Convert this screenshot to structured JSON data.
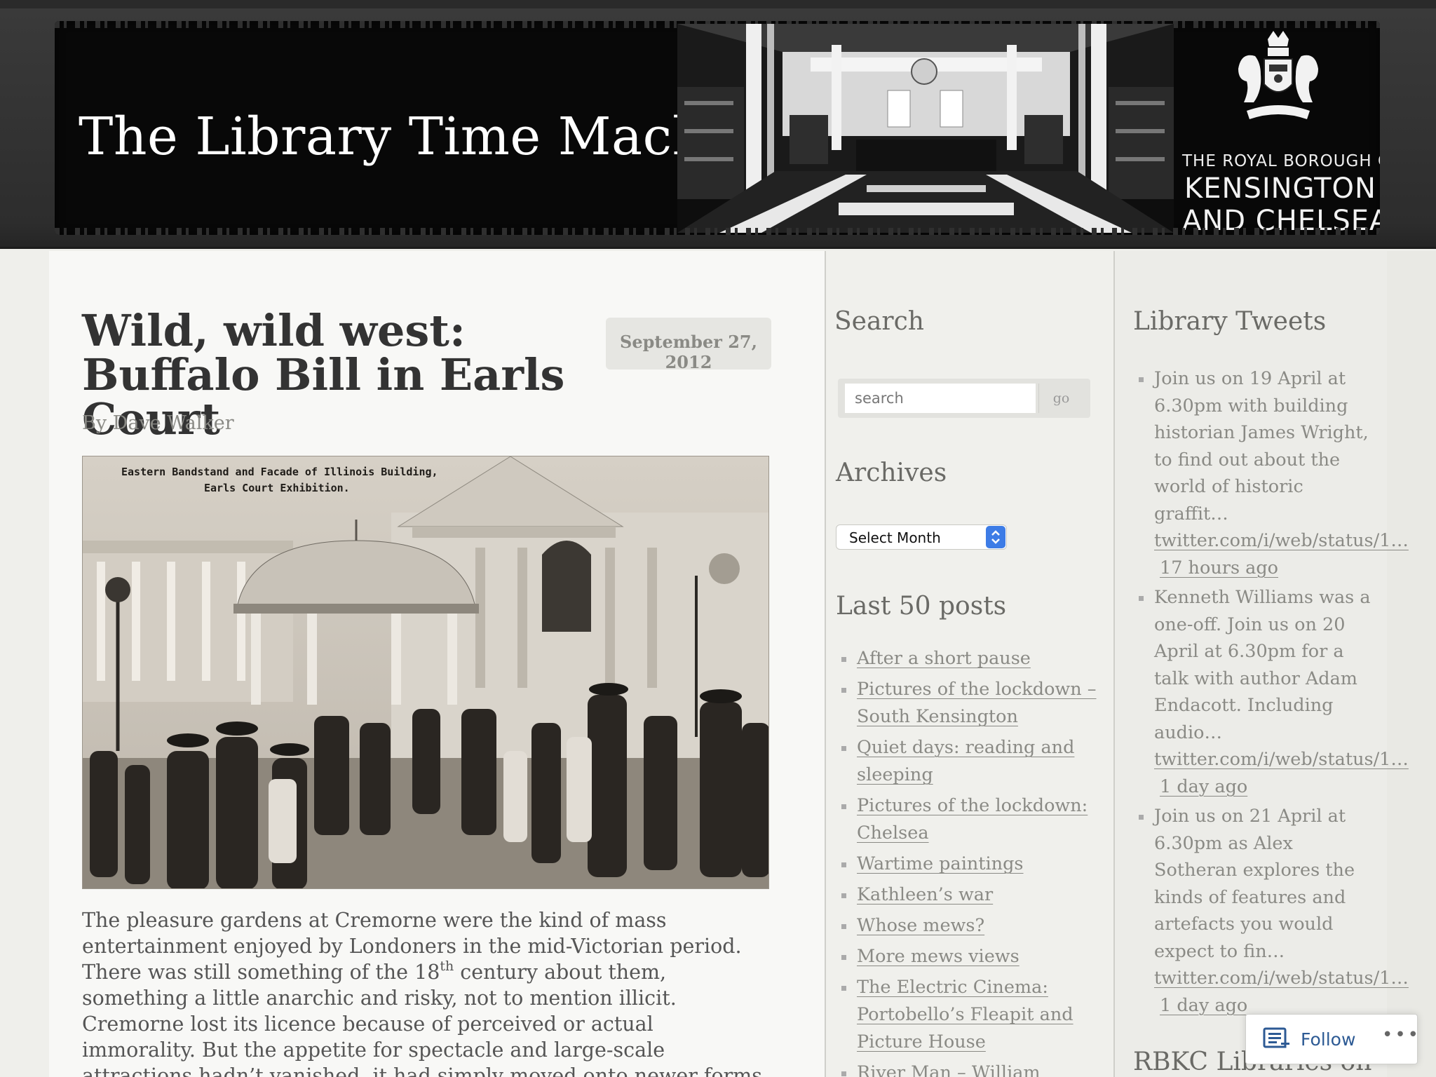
{
  "header": {
    "site_title": "The Library Time Machine",
    "borough_line1": "THE ROYAL BOROUGH OF",
    "borough_line2": "KENSINGTON",
    "borough_line3": "AND CHELSEA"
  },
  "post": {
    "title": "Wild, wild west: Buffalo Bill in Earls Court",
    "date": "September 27, 2012",
    "byline": "By Dave Walker",
    "image_caption_line1": "Eastern Bandstand and Facade of Illinois Building,",
    "image_caption_line2": "Earls Court Exhibition.",
    "body_part1": "The pleasure gardens at Cremorne were the kind of mass entertainment enjoyed by Londoners in the mid-Victorian period. There was still something of the 18",
    "body_sup": "th",
    "body_part2": " century about them, something a little anarchic and risky, not to mention illicit. Cremorne lost its licence because of perceived or actual immorality. But the appetite for spectacle and large-scale attractions hadn’t vanished, it had simply moved onto newer forms of entertainment."
  },
  "sidebar": {
    "search_title": "Search",
    "search_placeholder": "search",
    "search_button": "go",
    "archives_title": "Archives",
    "archives_selected": "Select Month",
    "last_posts_title": "Last 50 posts",
    "last_posts": [
      "After a short pause",
      "Pictures of the lockdown – South Kensington",
      "Quiet days: reading and sleeping",
      "Pictures of the lockdown: Chelsea",
      "Wartime paintings",
      "Kathleen’s war",
      "Whose mews?",
      "More mews views",
      "The Electric Cinema: Portobello’s Fleapit and Picture House",
      "River Man – William Ascroft"
    ]
  },
  "tweets": {
    "title": "Library Tweets",
    "items": [
      {
        "text": "Join us on 19 April at 6.30pm with building historian James Wright, to find out about the world of historic graffit…",
        "link": "twitter.com/i/web/status/1…",
        "time": "17 hours ago"
      },
      {
        "text": "Kenneth Williams was a one-off. Join us on 20 April at 6.30pm for a talk with author Adam Endacott. Including audio…",
        "link": "twitter.com/i/web/status/1…",
        "time": "1 day ago"
      },
      {
        "text": "Join us on 21 April at 6.30pm as Alex Sotheran explores the kinds of features and artefacts you would expect to fin…",
        "link": "twitter.com/i/web/status/1…",
        "time": "1 day ago"
      }
    ],
    "next_widget_title": "RBKC Libraries on"
  },
  "follow": {
    "label": "Follow",
    "more": "•••"
  },
  "colors": {
    "header_bg": "#2d2d2d",
    "banner_bg": "#080808",
    "link_grey": "#8a8a85",
    "follow_blue": "#2d5a94",
    "select_arrow_blue": "#3d7ce6"
  },
  "icons": {
    "crest": "royal-borough-crest-icon",
    "follow": "follow-reader-icon",
    "select_arrows": "select-updown-icon"
  }
}
